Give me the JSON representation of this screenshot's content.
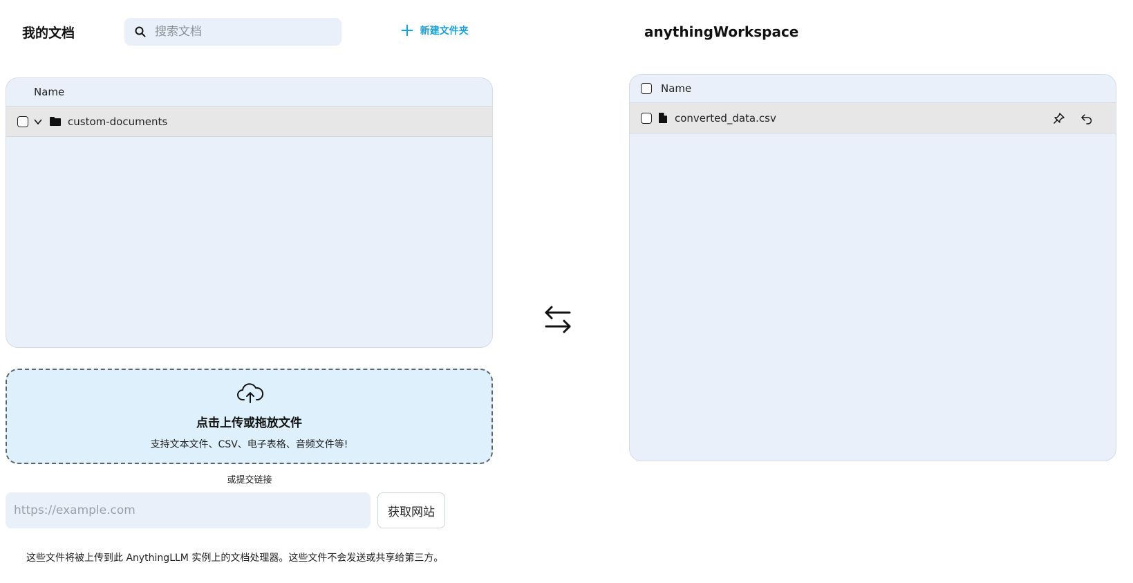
{
  "left": {
    "title": "我的文档",
    "search": {
      "placeholder": "搜索文档",
      "icon": "search-icon"
    },
    "new_folder_label": "新建文件夹",
    "table": {
      "column_name": "Name",
      "rows": [
        {
          "name": "custom-documents",
          "type": "folder",
          "expanded": true
        }
      ]
    },
    "upload": {
      "icon": "cloud-upload-icon",
      "title": "点击上传或拖放文件",
      "subtitle": "支持文本文件、CSV、电子表格、音频文件等!"
    },
    "or_submit_link": "或提交链接",
    "url_input": {
      "placeholder": "https://example.com",
      "value": ""
    },
    "fetch_button": "获取网站",
    "privacy_note": "这些文件将被上传到此 AnythingLLM 实例上的文档处理器。这些文件不会发送或共享给第三方。"
  },
  "swap_icon": "swap-arrows-icon",
  "right": {
    "title": "anythingWorkspace",
    "table": {
      "column_name": "Name",
      "rows": [
        {
          "name": "converted_data.csv",
          "type": "file",
          "actions": [
            "pin-icon",
            "undo-remove-icon"
          ]
        }
      ]
    }
  },
  "colors": {
    "accent": "#1a9fd8",
    "panel_bg": "#eaf0f9",
    "dropzone_bg": "#ddf0fc",
    "row_bg": "#e7e7e7"
  }
}
